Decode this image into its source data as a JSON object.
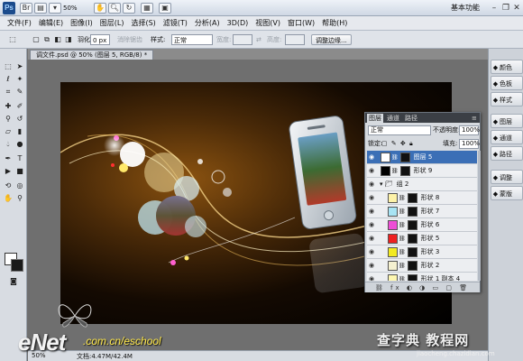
{
  "appbar": {
    "logo": "Ps",
    "zoom": "50%",
    "workspace": "基本功能",
    "window_controls": [
      "minimize-icon",
      "restore-icon",
      "close-icon"
    ]
  },
  "menubar": {
    "items": [
      "文件(F)",
      "编辑(E)",
      "图像(I)",
      "图层(L)",
      "选择(S)",
      "滤镜(T)",
      "分析(A)",
      "3D(D)",
      "视图(V)",
      "窗口(W)",
      "帮助(H)"
    ]
  },
  "options": {
    "feather_label": "羽化:",
    "feather_value": "0 px",
    "antialias_label": "消除锯齿",
    "style_label": "样式:",
    "style_value": "正常",
    "width_label": "宽度:",
    "height_label": "高度:",
    "refine_button": "调整边缘..."
  },
  "document": {
    "tab_title": "调文件.psd @ 50% (图层 5, RGB/8) *"
  },
  "status": {
    "zoom": "50%",
    "doc_info": "文档:4.47M/42.4M"
  },
  "dock": {
    "items": [
      {
        "label": "颜色",
        "icon": "color-icon"
      },
      {
        "label": "色板",
        "icon": "swatches-icon"
      },
      {
        "label": "样式",
        "icon": "styles-icon"
      },
      {
        "label": "图层",
        "icon": "layers-icon"
      },
      {
        "label": "通道",
        "icon": "channels-icon"
      },
      {
        "label": "路径",
        "icon": "paths-icon"
      },
      {
        "label": "调整",
        "icon": "adjustments-icon"
      },
      {
        "label": "蒙版",
        "icon": "masks-icon"
      }
    ]
  },
  "layers_panel": {
    "tabs": [
      "图层",
      "通道",
      "路径"
    ],
    "blend_mode": "正常",
    "opacity_label": "不透明度:",
    "opacity": "100%",
    "lock_label": "锁定:",
    "fill_label": "填充:",
    "fill": "100%",
    "layers": [
      {
        "name": "图层 5",
        "selected": true,
        "thumb": "#ffffff",
        "indent": 0
      },
      {
        "name": "形状 9",
        "selected": false,
        "thumb": "#000000",
        "indent": 0
      },
      {
        "name": "组 2",
        "selected": false,
        "thumb": "folder",
        "indent": 0
      },
      {
        "name": "形状 8",
        "selected": false,
        "thumb": "#fdf2a8",
        "indent": 1
      },
      {
        "name": "形状 7",
        "selected": false,
        "thumb": "#a8e4f4",
        "indent": 1
      },
      {
        "name": "形状 6",
        "selected": false,
        "thumb": "#ee4fd6",
        "indent": 1
      },
      {
        "name": "形状 5",
        "selected": false,
        "thumb": "#ee2020",
        "indent": 1
      },
      {
        "name": "形状 3",
        "selected": false,
        "thumb": "#f2ea22",
        "indent": 1
      },
      {
        "name": "形状 2",
        "selected": false,
        "thumb": "#f4f0d0",
        "indent": 1
      },
      {
        "name": "形状 1 副本 4",
        "selected": false,
        "thumb": "#fdf6b0",
        "indent": 1
      }
    ]
  },
  "watermarks": {
    "enet": "eNet",
    "domain": ".com.cn/eschool",
    "jb": "查字典 教程网",
    "jb_url": "jiaocheng.chazidian.com"
  }
}
